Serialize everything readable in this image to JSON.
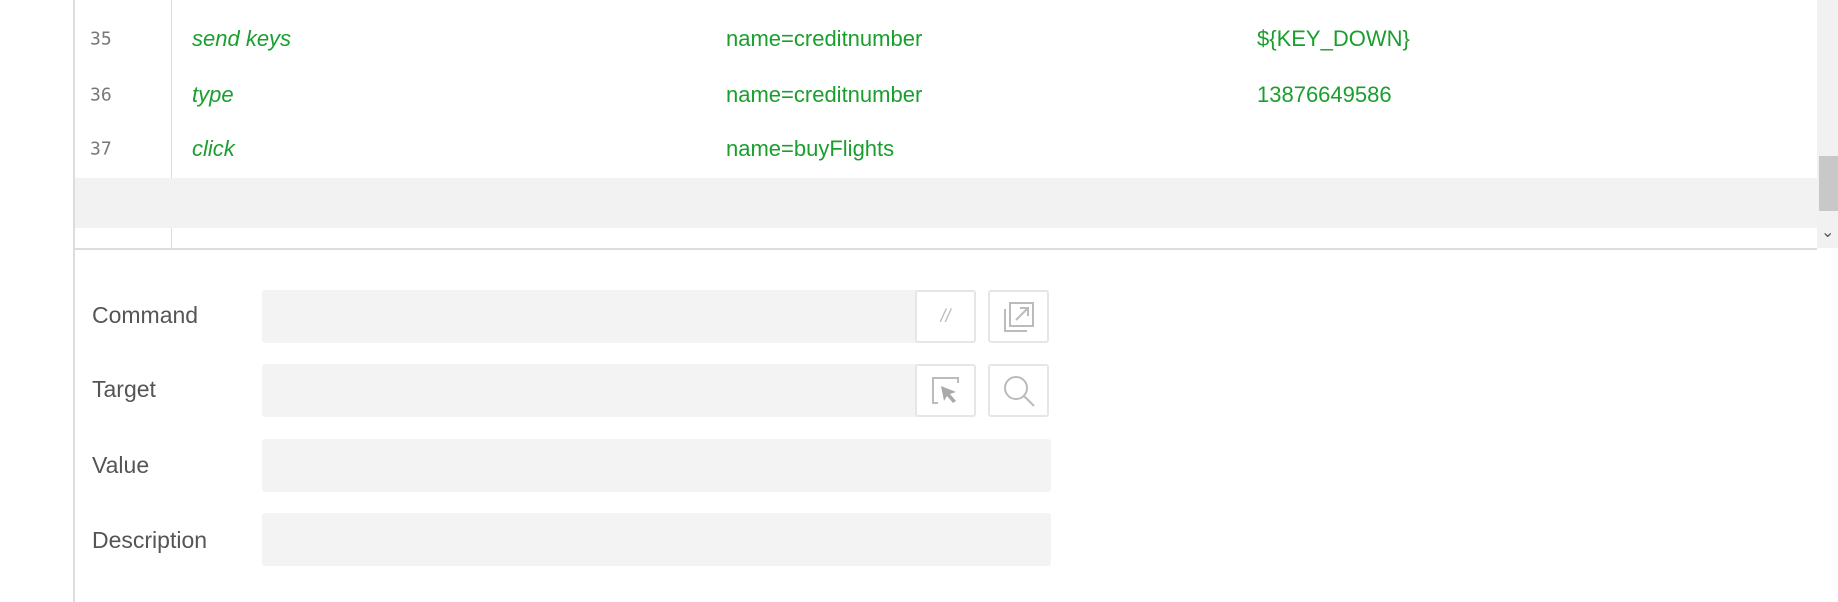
{
  "rows": [
    {
      "line": "35",
      "command": "send keys",
      "target": "name=creditnumber",
      "value": "${KEY_DOWN}"
    },
    {
      "line": "36",
      "command": "type",
      "target": "name=creditnumber",
      "value": "13876649586"
    },
    {
      "line": "37",
      "command": "click",
      "target": "name=buyFlights",
      "value": ""
    }
  ],
  "form": {
    "command_label": "Command",
    "target_label": "Target",
    "value_label": "Value",
    "description_label": "Description",
    "command_value": "",
    "target_value": "",
    "value_value": "",
    "description_value": "",
    "comment_button": "//"
  },
  "colors": {
    "command_text": "#1a9e2e"
  }
}
